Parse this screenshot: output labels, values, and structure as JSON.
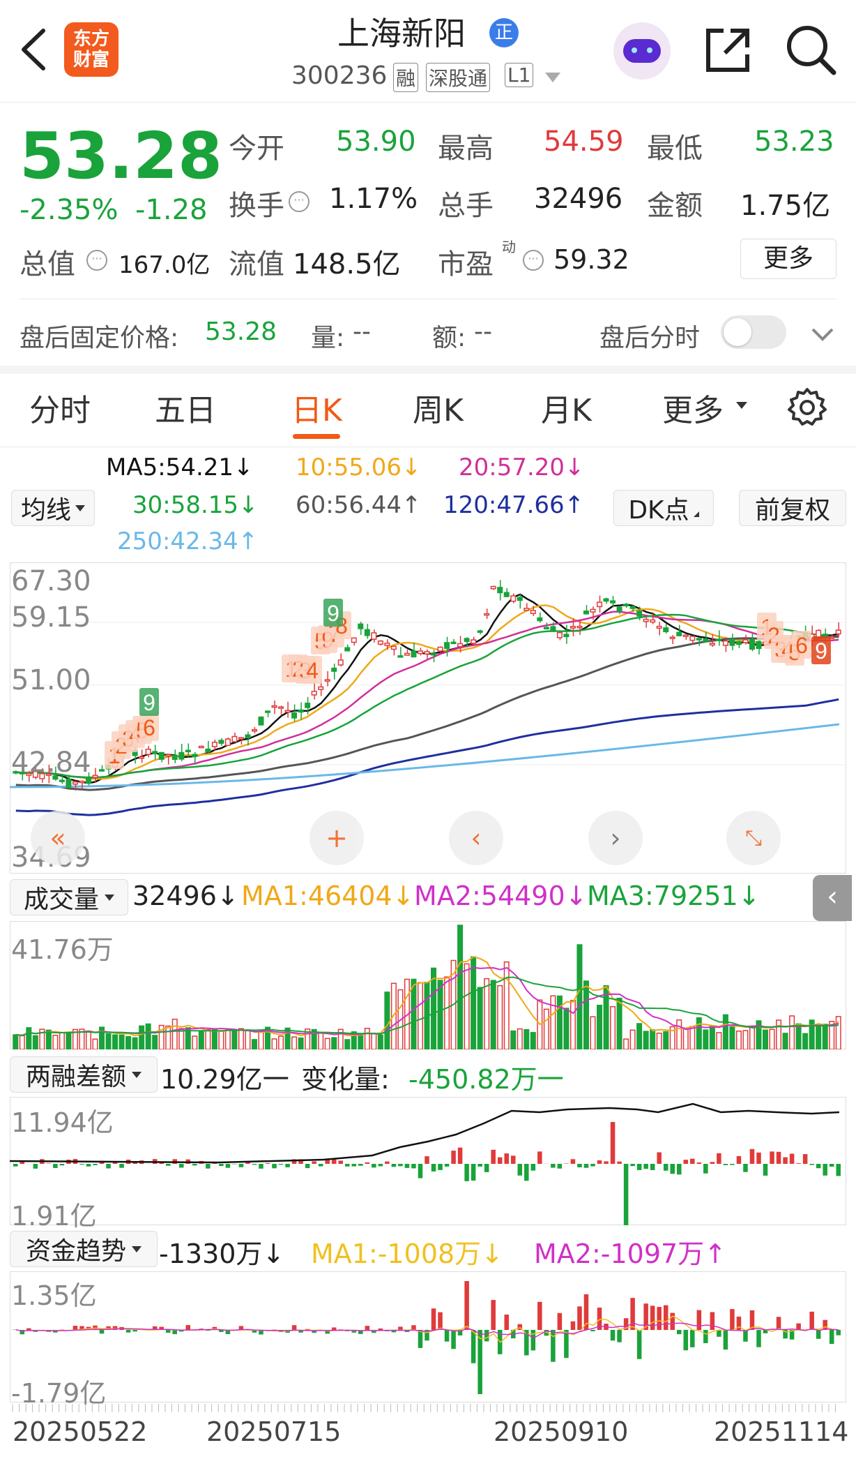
{
  "header": {
    "back_icon": "chevron-left-icon",
    "logo_line1": "东方",
    "logo_line2": "财富",
    "stock_name": "上海新阳",
    "badge": "正",
    "stock_code": "300236",
    "tag1": "融",
    "tag2": "深股通",
    "tag3": "L1",
    "robot_icon": "robot-icon",
    "share_icon": "share-icon",
    "search_icon": "search-icon"
  },
  "quote": {
    "price": "53.28",
    "change_pct": "-2.35%",
    "change_amt": "-1.28",
    "open_label": "今开",
    "open": "53.90",
    "high_label": "最高",
    "high": "54.59",
    "low_label": "最低",
    "low": "53.23",
    "turnover_label": "换手",
    "turnover": "1.17%",
    "vol_label": "总手",
    "vol": "32496",
    "amount_label": "金额",
    "amount": "1.75亿",
    "mcap_label": "总值",
    "mcap": "167.0亿",
    "float_label": "流值",
    "float": "148.5亿",
    "pe_label": "市盈",
    "pe_sup": "动",
    "pe": "59.32",
    "more_label": "更多"
  },
  "after_hours": {
    "label": "盘后固定价格:",
    "price": "53.28",
    "vol_label": "量:",
    "vol": "--",
    "amt_label": "额:",
    "amt": "--",
    "intraday_label": "盘后分时"
  },
  "tabs": [
    {
      "label": "分时"
    },
    {
      "label": "五日"
    },
    {
      "label": "日K"
    },
    {
      "label": "周K"
    },
    {
      "label": "月K"
    },
    {
      "label": "更多"
    }
  ],
  "ma": {
    "selector": "均线",
    "ma5": "MA5:54.21↓",
    "ma10": "10:55.06↓",
    "ma20": "20:57.20↓",
    "ma30": "30:58.15↓",
    "ma60": "60:56.44↑",
    "ma120": "120:47.66↑",
    "ma250": "250:42.34↑",
    "dk": "DK点",
    "adjust": "前复权"
  },
  "kline": {
    "y1": "67.30",
    "y2": "59.15",
    "y3": "51.00",
    "y4": "42.84",
    "y5": "34.69"
  },
  "volume": {
    "selector": "成交量",
    "value": "32496↓",
    "ma1": "MA1:46404↓",
    "ma2": "MA2:54490↓",
    "ma3": "MA3:79251↓",
    "ymax": "41.76万"
  },
  "margin": {
    "selector": "两融差额",
    "value": "10.29亿一",
    "change": "变化量:",
    "change_val": "-450.82万一",
    "ymax": "11.94亿",
    "ymin": "1.91亿"
  },
  "capital": {
    "selector": "资金趋势",
    "value": "-1330万↓",
    "ma1": "MA1:-1008万↓",
    "ma2": "MA2:-1097万↑",
    "ymax": "1.35亿",
    "ymin": "-1.79亿"
  },
  "dates": [
    "20250522",
    "20250715",
    "20250910",
    "20251114"
  ],
  "colors": {
    "up": "#e03a3a",
    "down": "#19a33a",
    "accent": "#f05a14",
    "ma5": "#111111",
    "ma10": "#f0a818",
    "ma20": "#d0309a",
    "ma30": "#19a33a",
    "ma60": "#555555",
    "ma120": "#1e2f9e",
    "ma250": "#6ab8e8"
  }
}
